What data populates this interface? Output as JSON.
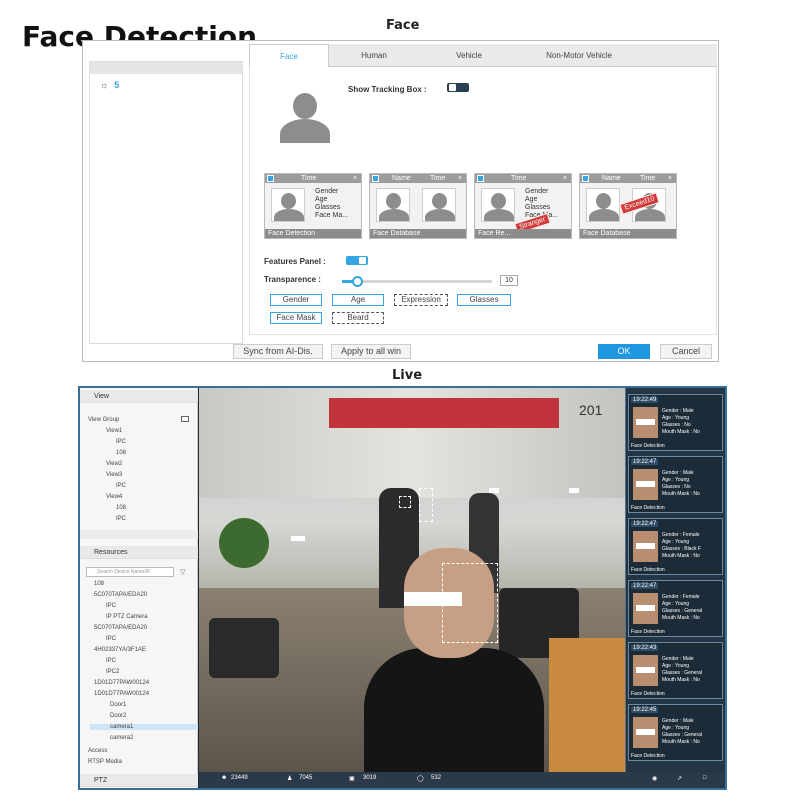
{
  "title": "Face Detection",
  "face_section_label": "Face",
  "live_section_label": "Live",
  "dialog": {
    "tabs": [
      "Face",
      "Human",
      "Vehicle",
      "Non-Motor Vehicle"
    ],
    "active_tab": "Face",
    "tree_camera": "5",
    "show_tracking_box_label": "Show Tracking Box :",
    "cards": [
      {
        "head_a": "Time",
        "head_b": "",
        "info": [
          "Gender",
          "Age",
          "Glasses",
          "Face Ma..."
        ],
        "footer": "Face Detection",
        "stamp": ""
      },
      {
        "head_a": "Name",
        "head_b": "Time",
        "info": [],
        "footer": "Face Database",
        "stamp": ""
      },
      {
        "head_a": "Time",
        "head_b": "",
        "info": [
          "Gender",
          "Age",
          "Glasses",
          "Face Ma..."
        ],
        "footer": "Face Re...",
        "stamp": "Stranger"
      },
      {
        "head_a": "Name",
        "head_b": "Time",
        "info": [],
        "footer": "Face Database",
        "stamp": "Exceed10"
      }
    ],
    "features_panel_label": "Features Panel :",
    "transparence_label": "Transparence :",
    "transparence_value": "10",
    "transparence_level": 0.1,
    "features": [
      {
        "label": "Gender",
        "style": "solid"
      },
      {
        "label": "Age",
        "style": "solid"
      },
      {
        "label": "Expression",
        "style": "dash"
      },
      {
        "label": "Glasses",
        "style": "solid"
      },
      {
        "label": "Face Mask",
        "style": "solid"
      },
      {
        "label": "Beard",
        "style": "dash"
      }
    ],
    "buttons": {
      "sync": "Sync from AI-Dis.",
      "apply": "Apply to all win",
      "ok": "OK",
      "cancel": "Cancel"
    },
    "accent": "#33a6e3"
  },
  "live": {
    "view_header": "View",
    "view_group": "View Group",
    "view_items": [
      "View1",
      "IPC",
      "108",
      "View2",
      "View3",
      "IPC",
      "View4",
      "108",
      "IPC"
    ],
    "resources_header": "Resources",
    "search_placeholder": "Search Device Name/IP",
    "resource_items": [
      "108",
      "5C070TAPA/EDA20",
      "IPC",
      "IP PTZ Camera",
      "5C070TAPA/EDA20",
      "IPC",
      "4H02337YA/3F1AE",
      "IPC",
      "IPC2",
      "1D01D77PAW00124",
      "1D01D77PAW00124",
      "Door1",
      "Door2",
      "camera1",
      "camera2"
    ],
    "access_label": "Access",
    "rtsp_label": "RTSP Media",
    "ptz_label": "PTZ",
    "stats": {
      "persons": "23449",
      "groups": "7045",
      "vehicles": "3019",
      "bikes": "532"
    },
    "timestamp_partial": "201",
    "captures": [
      {
        "time": "19:22:49",
        "gender": "Male",
        "age": "Young",
        "glasses": "No",
        "mask": "No",
        "label": "Face Detection"
      },
      {
        "time": "19:22:47",
        "gender": "Male",
        "age": "Young",
        "glasses": "No",
        "mask": "No",
        "label": "Face Detection"
      },
      {
        "time": "19:22:47",
        "gender": "Female",
        "age": "Young",
        "glasses": "Black F",
        "mask": "No",
        "label": "Face Detection"
      },
      {
        "time": "19:22:47",
        "gender": "Female",
        "age": "Young",
        "glasses": "General",
        "mask": "No",
        "label": "Face Detection"
      },
      {
        "time": "19:22:43",
        "gender": "Male",
        "age": "Young",
        "glasses": "General",
        "mask": "No",
        "label": "Face Detection"
      },
      {
        "time": "19:22:45",
        "gender": "Male",
        "age": "Young",
        "glasses": "General",
        "mask": "No",
        "label": "Face Detection"
      }
    ],
    "capture_keys": {
      "gender": "Gender :",
      "age": "Age :",
      "glasses": "Glasses :",
      "mask": "Mouth Mask :"
    }
  }
}
